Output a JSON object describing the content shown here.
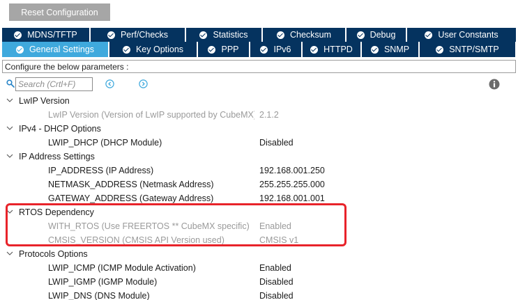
{
  "toolbar": {
    "reset_label": "Reset Configuration"
  },
  "tabs_row1": [
    {
      "label": "MDNS/TFTP"
    },
    {
      "label": "Perf/Checks"
    },
    {
      "label": "Statistics"
    },
    {
      "label": "Checksum"
    },
    {
      "label": "Debug"
    },
    {
      "label": "User Constants"
    }
  ],
  "tabs_row2": [
    {
      "label": "General Settings",
      "active": true
    },
    {
      "label": "Key Options"
    },
    {
      "label": "PPP"
    },
    {
      "label": "IPv6"
    },
    {
      "label": "HTTPD"
    },
    {
      "label": "SNMP"
    },
    {
      "label": "SNTP/SMTP"
    }
  ],
  "configure_text": "Configure the below parameters :",
  "search": {
    "placeholder": "Search (Crtl+F)"
  },
  "tree": {
    "groups": [
      {
        "label": "LwIP Version",
        "params": [
          {
            "name": "LwIP Version (Version of LwIP supported by CubeMX)",
            "value": "2.1.2",
            "disabled": true
          }
        ]
      },
      {
        "label": "IPv4 - DHCP Options",
        "params": [
          {
            "name": "LWIP_DHCP (DHCP Module)",
            "value": "Disabled"
          }
        ]
      },
      {
        "label": "IP Address Settings",
        "params": [
          {
            "name": "IP_ADDRESS (IP Address)",
            "value": "192.168.001.250"
          },
          {
            "name": "NETMASK_ADDRESS (Netmask Address)",
            "value": "255.255.255.000"
          },
          {
            "name": "GATEWAY_ADDRESS (Gateway Address)",
            "value": "192.168.001.001"
          }
        ]
      },
      {
        "label": "RTOS Dependency",
        "params": [
          {
            "name": "WITH_RTOS (Use FREERTOS ** CubeMX specific)",
            "value": "Enabled",
            "disabled": true
          },
          {
            "name": "CMSIS_VERSION (CMSIS API Version used)",
            "value": "CMSIS v1",
            "disabled": true
          }
        ]
      },
      {
        "label": "Protocols Options",
        "params": [
          {
            "name": "LWIP_ICMP (ICMP Module Activation)",
            "value": "Enabled"
          },
          {
            "name": "LWIP_IGMP (IGMP Module)",
            "value": "Disabled"
          },
          {
            "name": "LWIP_DNS (DNS Module)",
            "value": "Disabled"
          }
        ]
      }
    ]
  },
  "colors": {
    "tab_bg": "#05335f",
    "tab_active_bg": "#3fa9dd",
    "highlight": "#e8232a",
    "disabled_text": "#9a9a9a"
  },
  "icons": {
    "search": "search-icon",
    "prev": "chevron-left-circle-icon",
    "next": "chevron-right-circle-icon",
    "info": "info-icon",
    "tab": "check-circle-icon",
    "group": "chevron-down-icon"
  }
}
